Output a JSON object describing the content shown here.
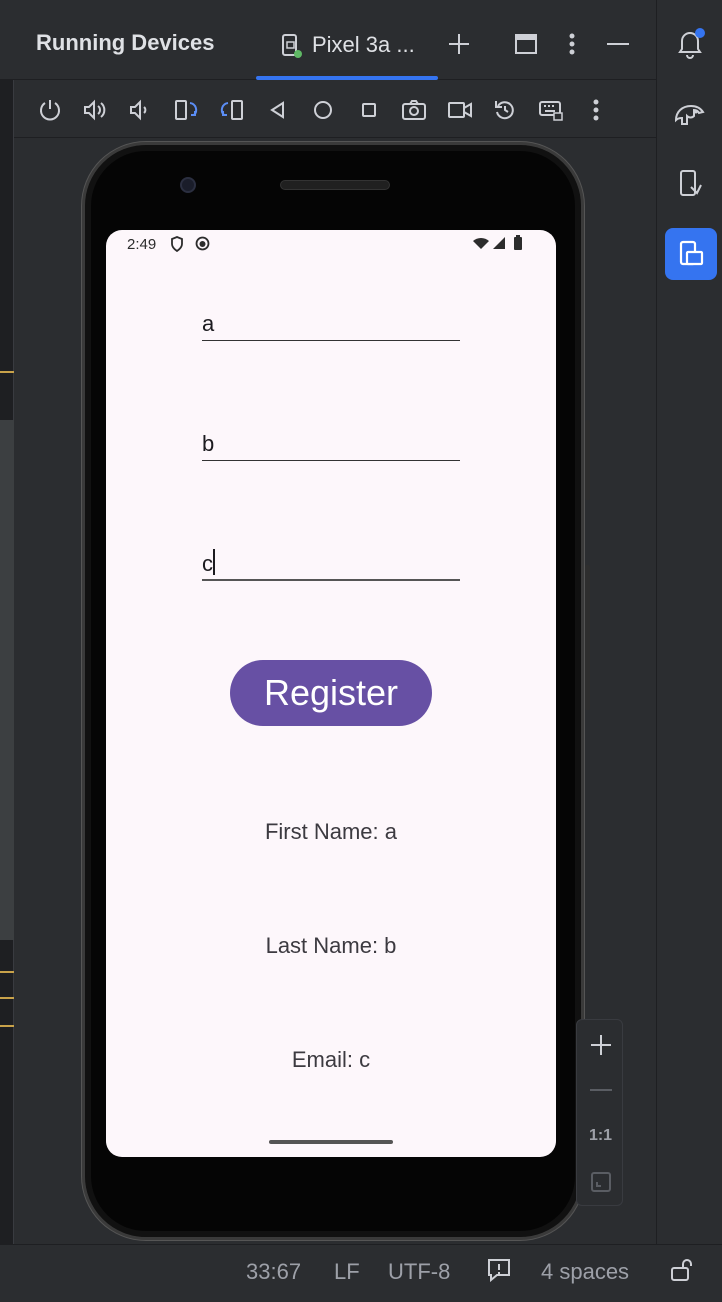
{
  "ide": {
    "panel_title": "Running Devices",
    "device_tab": "Pixel 3a ...",
    "toolbar_icons": [
      "power-icon",
      "volume-up-icon",
      "volume-down-icon",
      "rotate-left-icon",
      "rotate-right-icon",
      "back-icon",
      "home-icon",
      "overview-icon",
      "screenshot-icon",
      "screen-record-icon",
      "reset-icon",
      "keyboard-icon",
      "more-icon"
    ],
    "accent_color": "#3574f0"
  },
  "emulator": {
    "status_time": "2:49",
    "fields": {
      "first_name_value": "a",
      "last_name_value": "b",
      "email_value": "c"
    },
    "register_label": "Register",
    "results": {
      "first_name": "First Name: a",
      "last_name": "Last Name: b",
      "email": "Email: c"
    },
    "button_color": "#6750a4"
  },
  "zoom": {
    "actual_size": "1:1"
  },
  "statusbar": {
    "position": "33:67",
    "line_ending": "LF",
    "encoding": "UTF-8",
    "indent": "4 spaces"
  }
}
